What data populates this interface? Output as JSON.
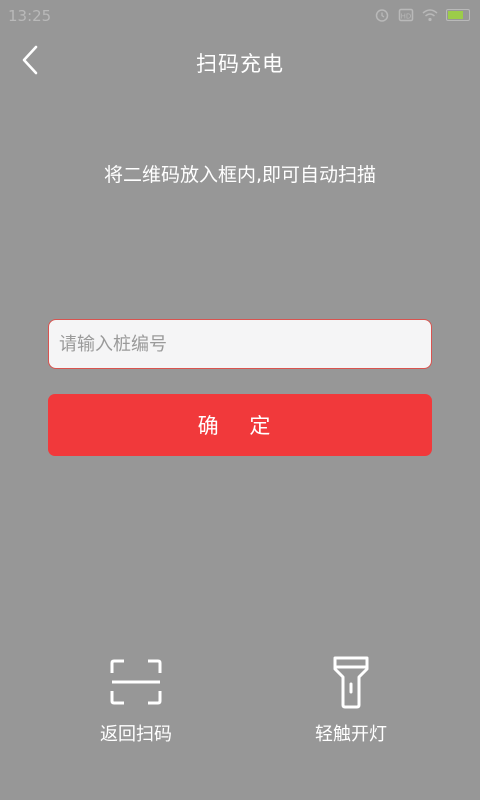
{
  "status_bar": {
    "time": "13:25"
  },
  "header": {
    "title": "扫码充电",
    "back_icon": "chevron-left-icon"
  },
  "instruction": "将二维码放入框内,即可自动扫描",
  "pile_input": {
    "placeholder": "请输入桩编号",
    "value": ""
  },
  "confirm_label": "确 定",
  "bottom_actions": [
    {
      "label": "返回扫码",
      "icon": "scan-frame-icon"
    },
    {
      "label": "轻触开灯",
      "icon": "flashlight-icon"
    }
  ],
  "colors": {
    "background": "#979797",
    "accent": "#f1393b",
    "input_border": "#d9534f"
  }
}
